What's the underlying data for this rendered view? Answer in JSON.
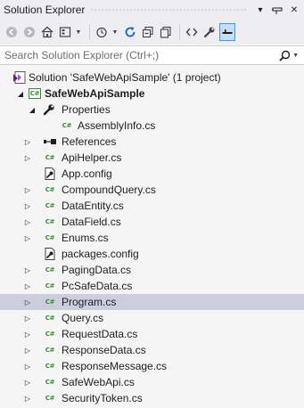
{
  "window": {
    "title": "Solution Explorer",
    "pin_glyph": "⊟",
    "close_glyph": "✕",
    "menu_glyph": "▾"
  },
  "toolbar": {
    "items": [
      {
        "icon": "back-icon",
        "glyph": "◀"
      },
      {
        "icon": "forward-icon",
        "glyph": "▶"
      },
      {
        "icon": "home-icon",
        "glyph": "⌂"
      },
      {
        "icon": "switch-views-icon",
        "glyph": "▣"
      },
      {
        "icon": "pending-changes-filter-icon",
        "glyph": "⏱"
      },
      {
        "icon": "sync-icon",
        "glyph": "↻"
      },
      {
        "icon": "collapse-all-icon",
        "glyph": "⊟"
      },
      {
        "icon": "show-all-files-icon",
        "glyph": "⧉"
      },
      {
        "icon": "view-code-icon",
        "glyph": "‹›"
      },
      {
        "icon": "properties-wrench-icon",
        "glyph": "🔧"
      },
      {
        "icon": "preview-selected-items-icon",
        "glyph": "▬"
      }
    ]
  },
  "search": {
    "placeholder": "Search Solution Explorer (Ctrl+;)",
    "icon": "search-icon"
  },
  "tree": {
    "nodes": [
      {
        "label": "Solution 'SafeWebApiSample' (1 project)",
        "icon": "solution-icon",
        "expander": "",
        "bold": false
      },
      {
        "label": "SafeWebApiSample",
        "icon": "csharp-project-icon",
        "expander": "◢",
        "bold": true
      },
      {
        "label": "Properties",
        "icon": "wrench-icon",
        "expander": "◢",
        "bold": false
      },
      {
        "label": "AssemblyInfo.cs",
        "icon": "csharp-file-icon",
        "expander": "",
        "bold": false
      },
      {
        "label": "References",
        "icon": "references-icon",
        "expander": "▷",
        "bold": false
      },
      {
        "label": "ApiHelper.cs",
        "icon": "csharp-file-icon",
        "expander": "▷",
        "bold": false
      },
      {
        "label": "App.config",
        "icon": "config-icon",
        "expander": "",
        "bold": false
      },
      {
        "label": "CompoundQuery.cs",
        "icon": "csharp-file-icon",
        "expander": "▷",
        "bold": false
      },
      {
        "label": "DataEntity.cs",
        "icon": "csharp-file-icon",
        "expander": "▷",
        "bold": false
      },
      {
        "label": "DataField.cs",
        "icon": "csharp-file-icon",
        "expander": "▷",
        "bold": false
      },
      {
        "label": "Enums.cs",
        "icon": "csharp-file-icon",
        "expander": "▷",
        "bold": false
      },
      {
        "label": "packages.config",
        "icon": "config-icon",
        "expander": "",
        "bold": false
      },
      {
        "label": "PagingData.cs",
        "icon": "csharp-file-icon",
        "expander": "▷",
        "bold": false
      },
      {
        "label": "PcSafeData.cs",
        "icon": "csharp-file-icon",
        "expander": "▷",
        "bold": false
      },
      {
        "label": "Program.cs",
        "icon": "csharp-file-icon",
        "expander": "▷",
        "bold": false,
        "selected": true
      },
      {
        "label": "Query.cs",
        "icon": "csharp-file-icon",
        "expander": "▷",
        "bold": false
      },
      {
        "label": "RequestData.cs",
        "icon": "csharp-file-icon",
        "expander": "▷",
        "bold": false
      },
      {
        "label": "ResponseData.cs",
        "icon": "csharp-file-icon",
        "expander": "▷",
        "bold": false
      },
      {
        "label": "ResponseMessage.cs",
        "icon": "csharp-file-icon",
        "expander": "▷",
        "bold": false
      },
      {
        "label": "SafeWebApi.cs",
        "icon": "csharp-file-icon",
        "expander": "▷",
        "bold": false
      },
      {
        "label": "SecurityToken.cs",
        "icon": "csharp-file-icon",
        "expander": "▷",
        "bold": false
      }
    ]
  },
  "glyphs": {
    "csharp": "C#"
  },
  "colors": {
    "panel_bg": "#f5f5f5",
    "toolbar_bg": "#eeeef2",
    "selection_bg": "#cccedb",
    "csharp_green": "#388a34",
    "accent_blue": "#1e64c8"
  }
}
